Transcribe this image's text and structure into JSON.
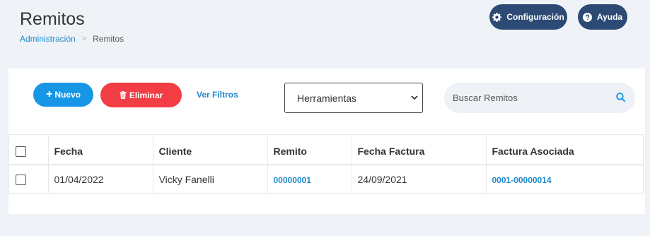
{
  "header": {
    "title": "Remitos",
    "breadcrumb": {
      "parent": "Administración",
      "separator": ">",
      "current": "Remitos"
    },
    "config_label": "Configuración",
    "help_label": "Ayuda"
  },
  "toolbar": {
    "new_label": "Nuevo",
    "delete_label": "Eliminar",
    "filters_label": "Ver Filtros",
    "select_value": "Herramientas",
    "search_placeholder": "Buscar Remitos"
  },
  "table": {
    "columns": [
      "Fecha",
      "Cliente",
      "Remito",
      "Fecha Factura",
      "Factura Asociada"
    ],
    "rows": [
      {
        "fecha": "01/04/2022",
        "cliente": "Vicky Fanelli",
        "remito": "00000001",
        "fecha_factura": "24/09/2021",
        "factura_asociada": "0001-00000014"
      }
    ]
  },
  "colors": {
    "primary_dark": "#2c4a73",
    "primary": "#1896e6",
    "danger": "#f23d44",
    "link": "#1e88c9",
    "background": "#eff3f7"
  },
  "icons": {
    "config": "gear-icon",
    "help": "question-circle-icon",
    "new": "plus-icon",
    "delete": "trash-icon",
    "select": "chevron-down-icon",
    "search": "search-icon"
  }
}
